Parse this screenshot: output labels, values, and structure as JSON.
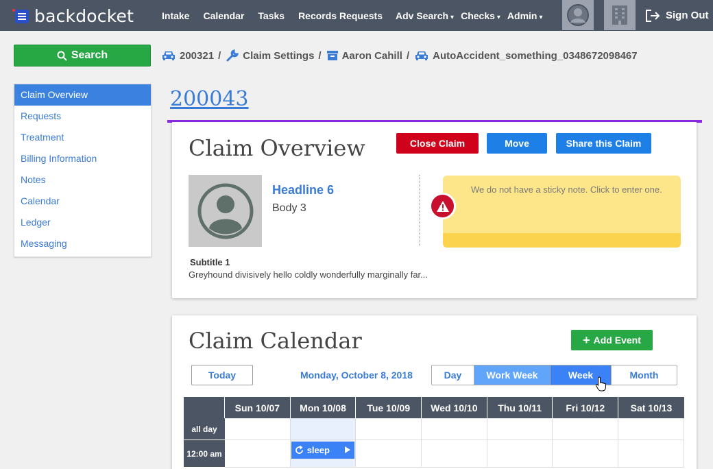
{
  "nav": {
    "brand": "backdocket",
    "items": [
      {
        "label": "Intake"
      },
      {
        "label": "Calendar"
      },
      {
        "label": "Tasks"
      },
      {
        "label": "Records Requests"
      },
      {
        "label": "Adv Search",
        "caret": "▾"
      },
      {
        "label": "Checks",
        "caret": "▾"
      },
      {
        "label": "Admin",
        "caret": "▾"
      }
    ],
    "sign_out": "Sign Out"
  },
  "search_label": "Search",
  "breadcrumb": [
    {
      "label": "200321",
      "icon": "car-icon"
    },
    {
      "label": "Claim Settings",
      "icon": "wrench-icon"
    },
    {
      "label": "Aaron Cahill",
      "icon": "archive-icon"
    },
    {
      "label": "AutoAccident_something_0348672098467",
      "icon": "car-icon"
    }
  ],
  "sidebar": {
    "items": [
      {
        "label": "Claim Overview",
        "active": true
      },
      {
        "label": "Requests"
      },
      {
        "label": "Treatment"
      },
      {
        "label": "Billing Information"
      },
      {
        "label": "Notes"
      },
      {
        "label": "Calendar"
      },
      {
        "label": "Ledger"
      },
      {
        "label": "Messaging"
      }
    ]
  },
  "claim_number": "200043",
  "overview": {
    "title": "Claim Overview",
    "close_label": "Close Claim",
    "move_label": "Move",
    "share_label": "Share this Claim",
    "headline": "Headline 6",
    "body": "Body 3",
    "subtitle": "Subtitle 1",
    "description": "Greyhound divisively hello coldly wonderfully marginally far...",
    "sticky_note": "We do not have a sticky note. Click to enter one."
  },
  "calendar": {
    "title": "Claim Calendar",
    "add_event_label": "Add Event",
    "today_label": "Today",
    "current_date": "Monday, October 8, 2018",
    "views": [
      "Day",
      "Work Week",
      "Week",
      "Month"
    ],
    "days": [
      "Sun 10/07",
      "Mon 10/08",
      "Tue 10/09",
      "Wed 10/10",
      "Thu 10/11",
      "Fri 10/12",
      "Sat 10/13"
    ],
    "all_day_label": "all day",
    "time_label": "12:00 am",
    "event_label": "sleep"
  },
  "colors": {
    "nav_bg": "#4b5563",
    "accent_blue": "#3a7bd5",
    "purple_rule": "#8a2be2",
    "danger": "#d0021b",
    "success": "#28a745"
  }
}
